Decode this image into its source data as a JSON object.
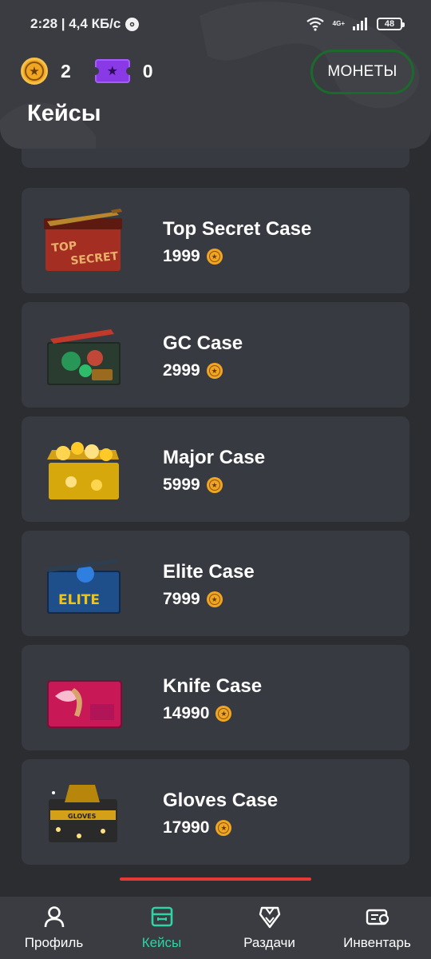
{
  "status_bar": {
    "time_speed": "2:28 | 4,4 КБ/с",
    "network": "4G+",
    "battery": "48"
  },
  "header": {
    "coin_count": "2",
    "ticket_count": "0",
    "coins_button": "МОНЕТЫ",
    "title": "Кейсы"
  },
  "cases": [
    {
      "name": "Top Secret Case",
      "price": "1999",
      "image_icon": "top-secret-case-image",
      "accent": "#c0392b"
    },
    {
      "name": "GC Case",
      "price": "2999",
      "image_icon": "gc-case-image",
      "accent": "#2ecc71"
    },
    {
      "name": "Major Case",
      "price": "5999",
      "image_icon": "major-case-image",
      "accent": "#f1c40f"
    },
    {
      "name": "Elite Case",
      "price": "7999",
      "image_icon": "elite-case-image",
      "accent": "#1e6fd9"
    },
    {
      "name": "Knife Case",
      "price": "14990",
      "image_icon": "knife-case-image",
      "accent": "#e91e63"
    },
    {
      "name": "Gloves Case",
      "price": "17990",
      "image_icon": "gloves-case-image",
      "accent": "#d4a017"
    }
  ],
  "nav": {
    "profile": "Профиль",
    "cases": "Кейсы",
    "giveaways": "Раздачи",
    "inventory": "Инвентарь",
    "active": "cases"
  },
  "colors": {
    "background": "#2b2d31",
    "card": "#383a41",
    "accent_green": "#2fd3a6",
    "coin": "#f0a623",
    "ticket": "#8a39e6",
    "coins_button_border": "#1b6a2c"
  }
}
